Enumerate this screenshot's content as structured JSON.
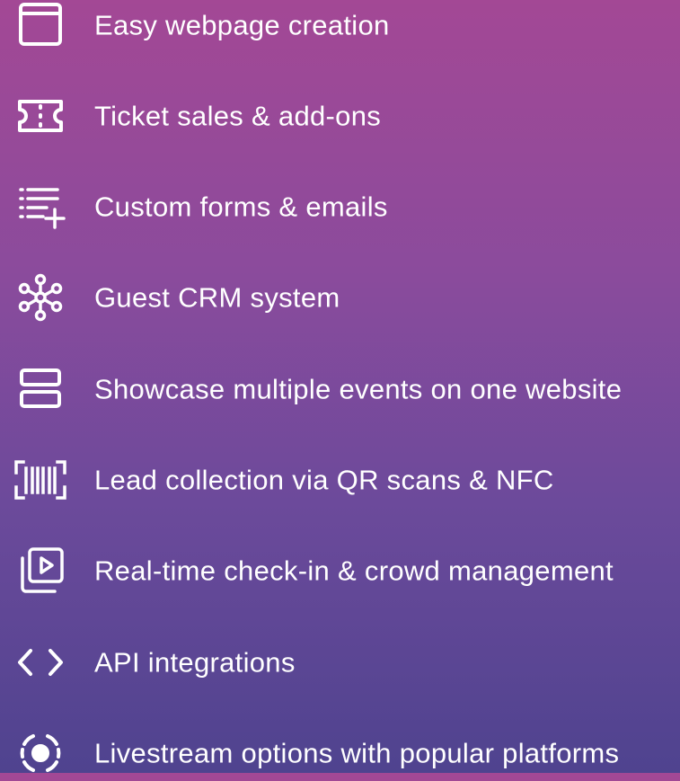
{
  "features": {
    "items": [
      {
        "label": "Easy webpage creation",
        "icon": "browser-window-icon"
      },
      {
        "label": "Ticket sales & add-ons",
        "icon": "ticket-icon"
      },
      {
        "label": "Custom forms & emails",
        "icon": "list-add-icon"
      },
      {
        "label": "Guest CRM system",
        "icon": "network-icon"
      },
      {
        "label": "Showcase multiple events on one website",
        "icon": "stacked-panels-icon"
      },
      {
        "label": "Lead collection via QR scans & NFC",
        "icon": "barcode-scan-icon"
      },
      {
        "label": "Real-time check-in & crowd management",
        "icon": "media-gallery-icon"
      },
      {
        "label": "API integrations",
        "icon": "code-brackets-icon"
      },
      {
        "label": "Livestream options with popular platforms",
        "icon": "broadcast-icon"
      }
    ]
  },
  "colors": {
    "background_top": "#a34895",
    "background_bottom": "#4f438f",
    "text": "#ffffff"
  }
}
